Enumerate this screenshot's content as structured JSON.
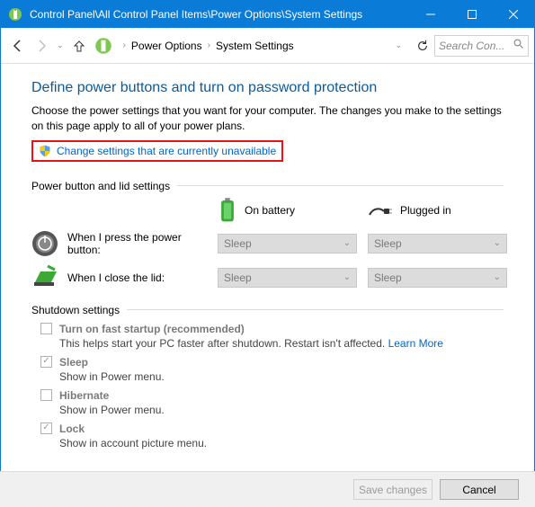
{
  "window": {
    "title": "Control Panel\\All Control Panel Items\\Power Options\\System Settings"
  },
  "breadcrumbs": {
    "a": "Power Options",
    "b": "System Settings"
  },
  "search": {
    "placeholder": "Search Con..."
  },
  "heading": "Define power buttons and turn on password protection",
  "description": "Choose the power settings that you want for your computer. The changes you make to the settings on this page apply to all of your power plans.",
  "change_link": "Change settings that are currently unavailable",
  "group1": {
    "title": "Power button and lid settings",
    "col_battery": "On battery",
    "col_plugged": "Plugged in",
    "row1_label": "When I press the power button:",
    "row2_label": "When I close the lid:",
    "row1_bat": "Sleep",
    "row1_plug": "Sleep",
    "row2_bat": "Sleep",
    "row2_plug": "Sleep"
  },
  "group2": {
    "title": "Shutdown settings",
    "fast_title": "Turn on fast startup (recommended)",
    "fast_sub": "This helps start your PC faster after shutdown. Restart isn't affected. ",
    "learn": "Learn More",
    "sleep_title": "Sleep",
    "sleep_sub": "Show in Power menu.",
    "hib_title": "Hibernate",
    "hib_sub": "Show in Power menu.",
    "lock_title": "Lock",
    "lock_sub": "Show in account picture menu."
  },
  "buttons": {
    "save": "Save changes",
    "cancel": "Cancel"
  }
}
